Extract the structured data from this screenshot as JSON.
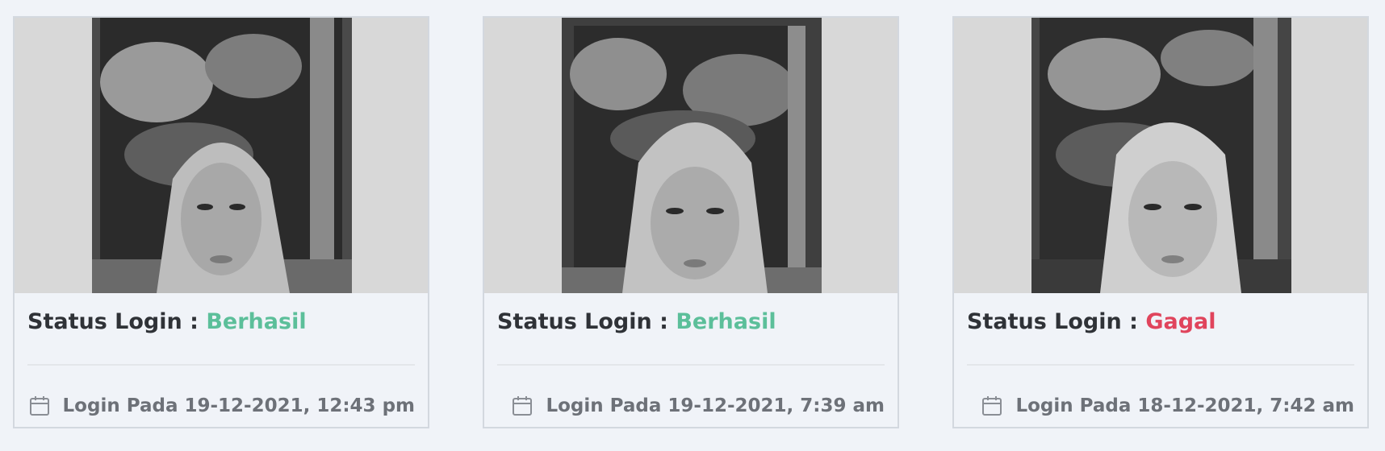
{
  "cards": [
    {
      "status_label": "Status Login :",
      "status_value": "Berhasil",
      "status_color": "#5cbf9a",
      "login_prefix": "Login Pada",
      "login_time": "19-12-2021, 12:43 pm",
      "icon": "calendar-icon"
    },
    {
      "status_label": "Status Login :",
      "status_value": "Berhasil",
      "status_color": "#5cbf9a",
      "login_prefix": "Login Pada",
      "login_time": "19-12-2021, 7:39 am",
      "icon": "calendar-icon"
    },
    {
      "status_label": "Status Login :",
      "status_value": "Gagal",
      "status_color": "#e0445c",
      "login_prefix": "Login Pada",
      "login_time": "18-12-2021, 7:42 am",
      "icon": "calendar-icon"
    }
  ]
}
